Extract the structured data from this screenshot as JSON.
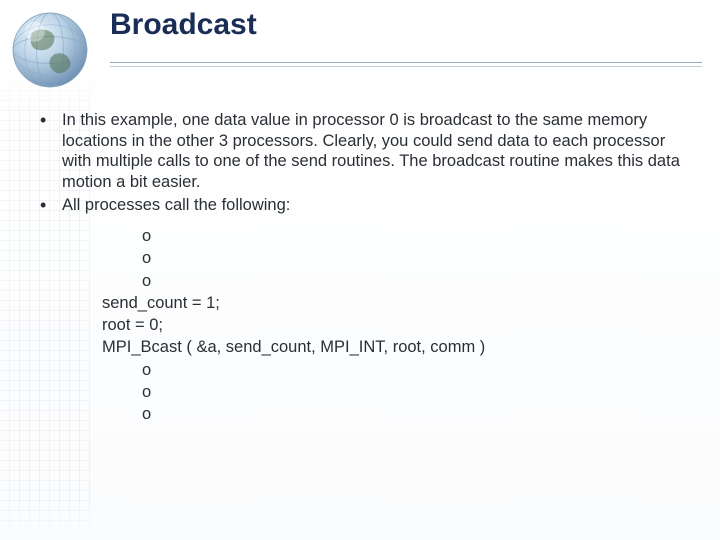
{
  "title": "Broadcast",
  "bullets": [
    "In this example, one data value in processor 0 is broadcast to the same memory locations in the other 3 processors. Clearly, you could send data to each processor with multiple calls to one of the send routines. The broadcast routine makes this data motion a bit easier.",
    "All processes call the following:"
  ],
  "code": {
    "pre1": "o",
    "pre2": "o",
    "pre3": "o",
    "line1": "send_count = 1;",
    "line2": "root = 0;",
    "line3": "MPI_Bcast ( &a, send_count, MPI_INT, root, comm )",
    "post1": "o",
    "post2": "o",
    "post3": "o"
  }
}
